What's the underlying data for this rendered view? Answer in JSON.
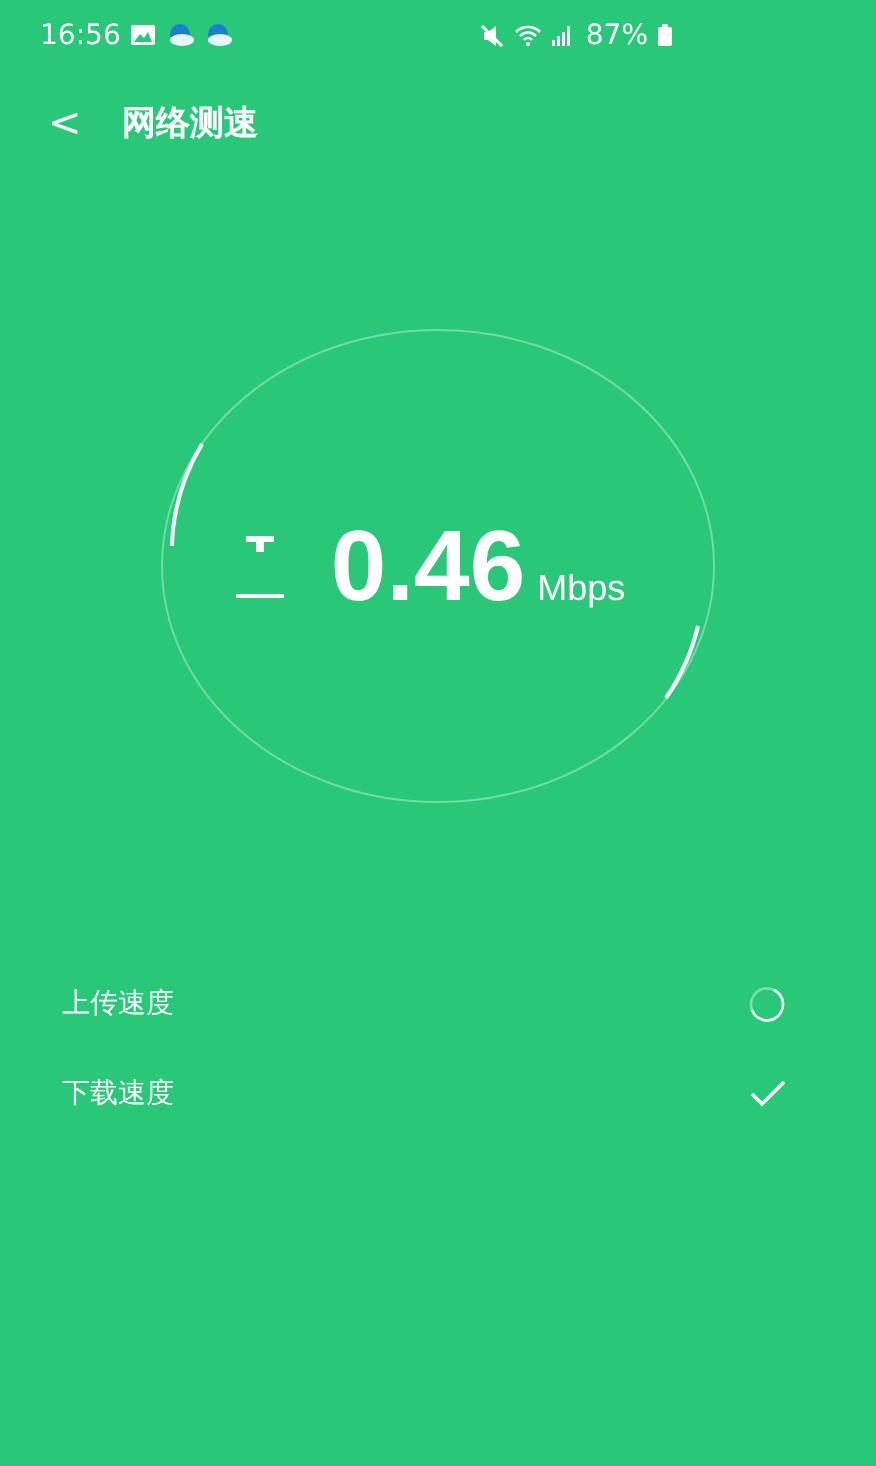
{
  "status_bar": {
    "time": "16:56",
    "battery": "87%"
  },
  "header": {
    "back": "<",
    "title": "网络测速"
  },
  "meter": {
    "value": "0.46",
    "unit": "Mbps"
  },
  "tests": [
    {
      "label": "上传速度",
      "kind": "running"
    },
    {
      "label": "下载速度",
      "kind": "done"
    }
  ]
}
